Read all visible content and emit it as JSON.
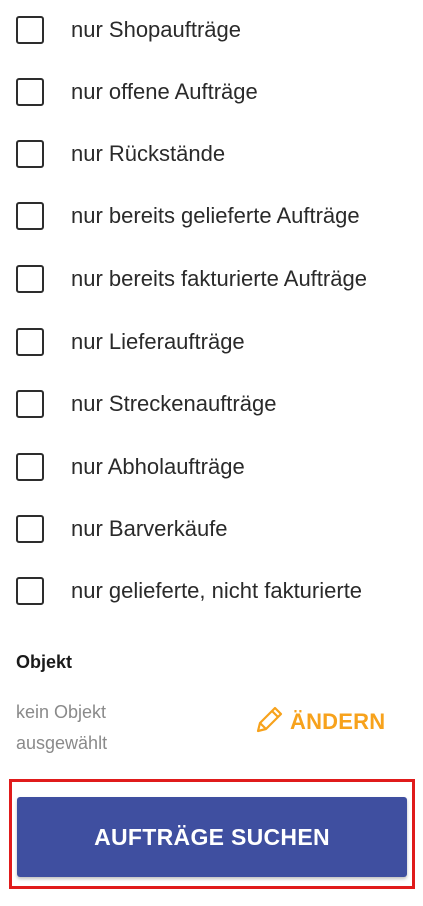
{
  "filters": [
    {
      "label": "nur Shopaufträge",
      "checked": false
    },
    {
      "label": "nur offene Aufträge",
      "checked": false
    },
    {
      "label": "nur Rückstände",
      "checked": false
    },
    {
      "label": "nur bereits gelieferte Aufträge",
      "checked": false
    },
    {
      "label": "nur bereits fakturierte Aufträge",
      "checked": false
    },
    {
      "label": "nur Lieferaufträge",
      "checked": false
    },
    {
      "label": "nur Streckenaufträge",
      "checked": false
    },
    {
      "label": "nur Abholaufträge",
      "checked": false
    },
    {
      "label": "nur Barverkäufe",
      "checked": false
    },
    {
      "label": "nur gelieferte, nicht fakturierte",
      "checked": false
    }
  ],
  "objekt": {
    "heading": "Objekt",
    "value": "kein Objekt ausgewählt",
    "change_label": "ÄNDERN",
    "change_icon": "pencil-icon"
  },
  "search_button": {
    "label": "AUFTRÄGE SUCHEN"
  },
  "colors": {
    "accent_orange": "#f7a21c",
    "button_blue": "#3f4fa0",
    "highlight_red": "#e01b1b",
    "muted_text": "#8a8a8a"
  }
}
